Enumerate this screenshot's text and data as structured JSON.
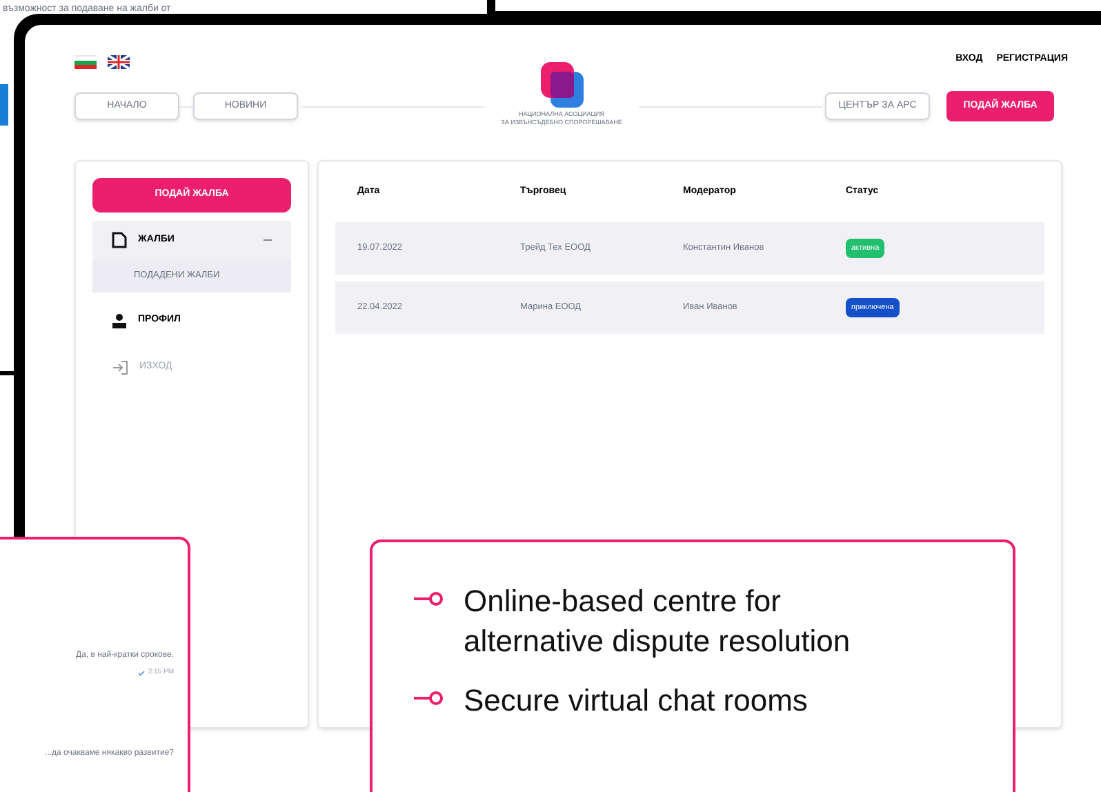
{
  "back_window": {
    "text": "възможност за подаване на жалби от"
  },
  "header": {
    "auth_links": [
      "ВХОД",
      "РЕГИСТРАЦИЯ"
    ],
    "nav_left": [
      "НАЧАЛО",
      "НОВИНИ"
    ],
    "nav_right": [
      "ЦЕНТЪР ЗА АРС"
    ],
    "cta": "ПОДАЙ ЖАЛБА",
    "logo_text": [
      "НАЦИОНАЛНА АСОЦИАЦИЯ",
      "ЗА ИЗВЪНСЪДЕБНО СПОРОРЕШАВАНЕ"
    ]
  },
  "sidebar": {
    "button": "ПОДАЙ ЖАЛБА",
    "items": [
      {
        "kind": "file",
        "label": "ЖАЛБИ",
        "expanded": true,
        "selected": true,
        "children": [
          {
            "label": "ПОДАДЕНИ ЖАЛБИ",
            "selected": true
          }
        ]
      },
      {
        "kind": "user",
        "label": "ПРОФИЛ",
        "selected": false
      },
      {
        "kind": "logout",
        "label": "ИЗХОД",
        "selected": false
      }
    ]
  },
  "table": {
    "columns": [
      "Дата",
      "Търговец",
      "Модератор",
      "Статус"
    ],
    "rows": [
      {
        "date": "19.07.2022",
        "merchant": "Трейд Тех ЕООД",
        "moderator": "Константин Иванов",
        "status": "активна",
        "color": "#22c06e"
      },
      {
        "date": "22.04.2022",
        "merchant": "Марина ЕООД",
        "moderator": "Иван Иванов",
        "status": "приключена",
        "color": "#1450c8"
      }
    ]
  },
  "chat": {
    "messages": [
      {
        "text": "Да, в най-кратки срокове.",
        "time": "2:15 PM"
      },
      {
        "text": "...да очакваме някакво развитие?"
      }
    ]
  },
  "features": [
    "Online-based centre for alternative dispute resolution",
    "Secure virtual chat rooms"
  ]
}
